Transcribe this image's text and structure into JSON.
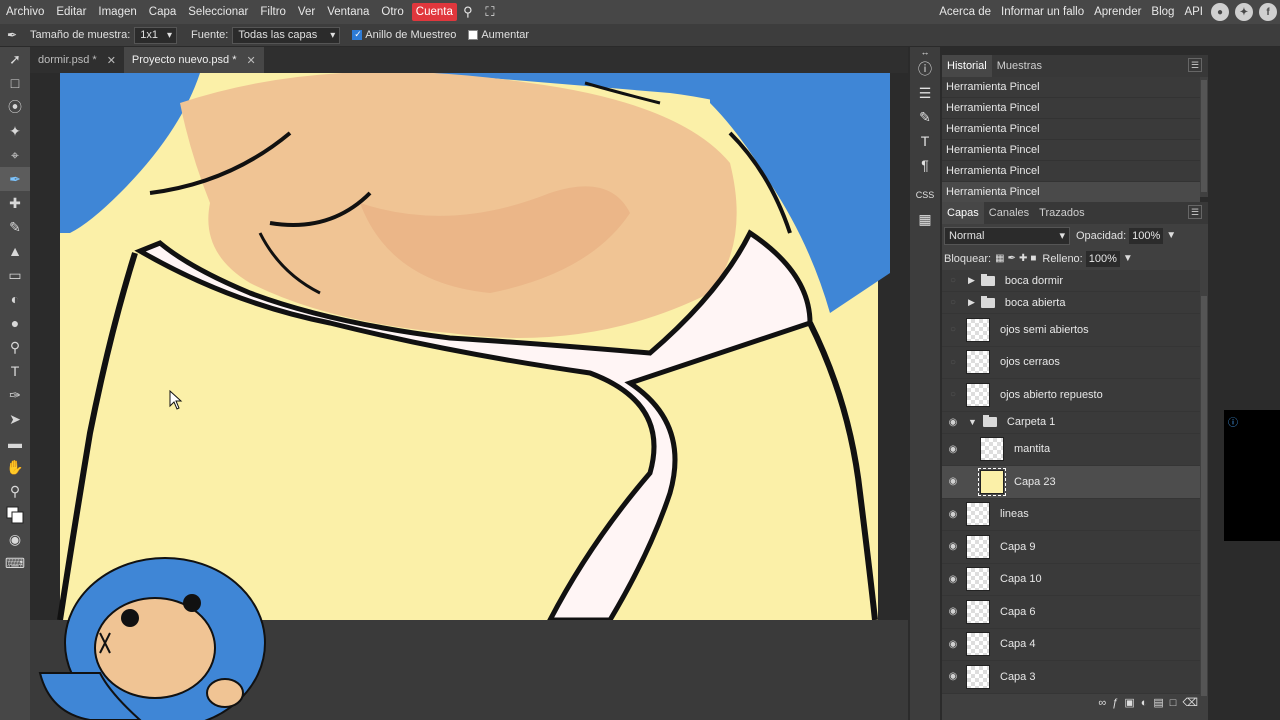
{
  "menu": {
    "items": [
      "Archivo",
      "Editar",
      "Imagen",
      "Capa",
      "Seleccionar",
      "Filtro",
      "Ver",
      "Ventana",
      "Otro"
    ],
    "account": "Cuenta",
    "right": [
      "Acerca de",
      "Informar un fallo",
      "Aprender",
      "Blog",
      "API"
    ]
  },
  "options": {
    "sample_size_label": "Tamaño de muestra:",
    "sample_size_value": "1x1",
    "source_label": "Fuente:",
    "source_value": "Todas las capas",
    "ring_label": "Anillo de Muestreo",
    "ring_checked": true,
    "enlarge_label": "Aumentar",
    "enlarge_checked": false
  },
  "tabs": [
    {
      "label": "dormir.psd *",
      "active": false
    },
    {
      "label": "Proyecto nuevo.psd *",
      "active": true
    }
  ],
  "history_panel": {
    "tabs": [
      "Historial",
      "Muestras"
    ],
    "items": [
      "Herramienta Pincel",
      "Herramienta Pincel",
      "Herramienta Pincel",
      "Herramienta Pincel",
      "Herramienta Pincel",
      "Herramienta Pincel"
    ]
  },
  "layers_panel": {
    "tabs": [
      "Capas",
      "Canales",
      "Trazados"
    ],
    "blend_mode": "Normal",
    "opacity_label": "Opacidad:",
    "opacity_value": "100%",
    "lock_label": "Bloquear:",
    "fill_label": "Relleno:",
    "fill_value": "100%",
    "layers": [
      {
        "name": "boca dormir",
        "type": "folder",
        "visible": false
      },
      {
        "name": "boca abierta",
        "type": "folder",
        "visible": false
      },
      {
        "name": "ojos semi abiertos",
        "type": "layer",
        "visible": false
      },
      {
        "name": "ojos cerraos",
        "type": "layer",
        "visible": false
      },
      {
        "name": "ojos abierto repuesto",
        "type": "layer",
        "visible": false
      },
      {
        "name": "Carpeta 1",
        "type": "folder-open",
        "visible": true
      },
      {
        "name": "mantita",
        "type": "layer",
        "visible": true
      },
      {
        "name": "Capa 23",
        "type": "layer",
        "visible": true,
        "selected": true
      },
      {
        "name": "lineas",
        "type": "layer",
        "visible": true
      },
      {
        "name": "Capa 9",
        "type": "layer",
        "visible": true
      },
      {
        "name": "Capa 10",
        "type": "layer",
        "visible": true
      },
      {
        "name": "Capa 6",
        "type": "layer",
        "visible": true
      },
      {
        "name": "Capa 4",
        "type": "layer",
        "visible": true
      },
      {
        "name": "Capa 3",
        "type": "layer",
        "visible": true
      }
    ]
  },
  "colors": {
    "account": "#e0373d",
    "blanket": "#fbf0a8",
    "hair": "#3f86d6",
    "skin": "#f0c494"
  }
}
